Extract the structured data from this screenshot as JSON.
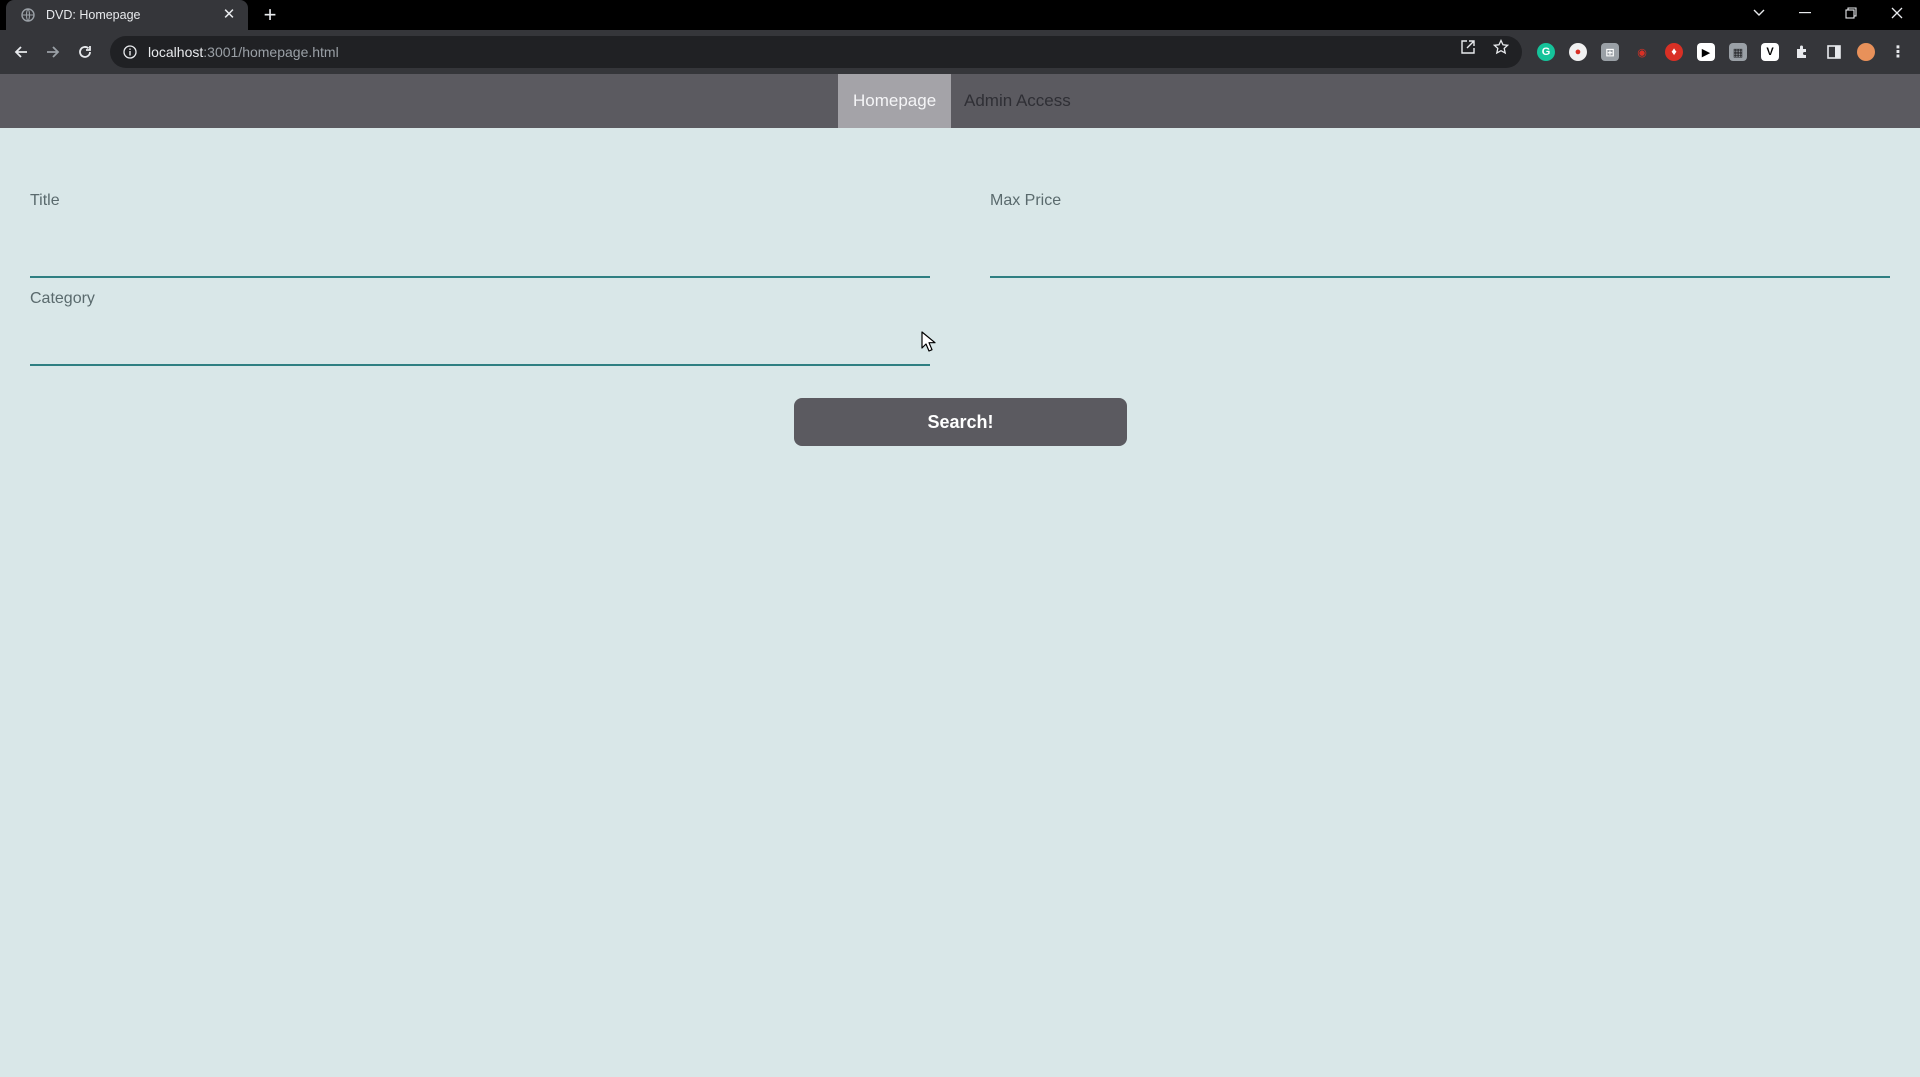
{
  "browser": {
    "tab_title": "DVD: Homepage",
    "tab_close": "✕",
    "new_tab": "+",
    "url_host": "localhost",
    "url_path": ":3001/homepage.html",
    "icons": [
      "back-arrow-icon",
      "forward-arrow-icon",
      "reload-icon",
      "info-icon",
      "share-icon",
      "star-icon",
      "extensions-puzzle-icon",
      "side-panel-icon",
      "profile-avatar-icon",
      "more-menu-icon"
    ]
  },
  "nav": {
    "items": [
      {
        "label": "Homepage",
        "active": true
      },
      {
        "label": "Admin Access",
        "active": false
      }
    ]
  },
  "form": {
    "title_label": "Title",
    "title_value": "",
    "max_price_label": "Max Price",
    "max_price_value": "",
    "category_label": "Category",
    "category_value": "",
    "search_label": "Search!"
  },
  "colors": {
    "page_bg": "#d9e7e8",
    "navbar_bg": "#5b5a60",
    "nav_active_bg": "#a4a3a8",
    "underline": "#2f7f82",
    "button_bg": "#5b5a60"
  }
}
